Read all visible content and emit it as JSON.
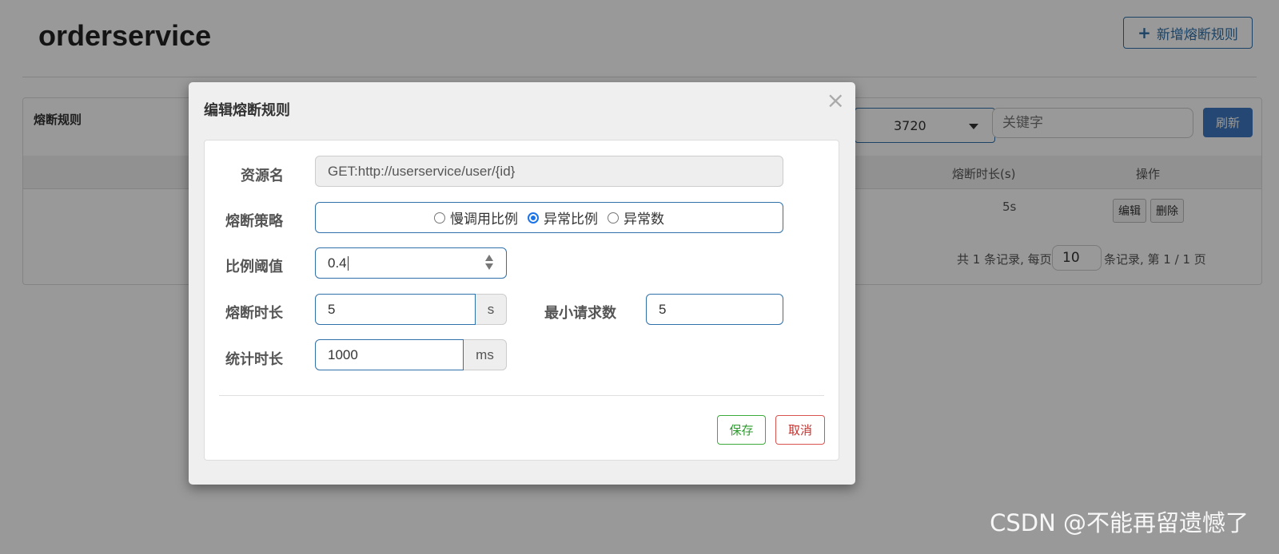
{
  "page": {
    "title": "orderservice",
    "add_rule_label": "新增熔断规则"
  },
  "panel": {
    "title": "熔断规则",
    "ip_select_value": "3720",
    "search_placeholder": "关键字",
    "refresh_label": "刷新",
    "columns": [
      "熔断时长(s)",
      "操作"
    ],
    "rows": [
      {
        "duration": "5s",
        "edit_label": "编辑",
        "delete_label": "删除"
      }
    ],
    "pager": {
      "prefix": "共 1 条记录, 每页",
      "page_size": "10",
      "suffix": "条记录, 第 1 / 1 页"
    }
  },
  "modal": {
    "title": "编辑熔断规则",
    "close_glyph": "×",
    "resource": {
      "label": "资源名",
      "value": "GET:http://userservice/user/{id}"
    },
    "strategy": {
      "label": "熔断策略",
      "options": [
        {
          "label": "慢调用比例",
          "checked": false
        },
        {
          "label": "异常比例",
          "checked": true
        },
        {
          "label": "异常数",
          "checked": false
        }
      ]
    },
    "ratio": {
      "label": "比例阈值",
      "value": "0.4"
    },
    "duration": {
      "label": "熔断时长",
      "value": "5",
      "unit": "s"
    },
    "min_request": {
      "label": "最小请求数",
      "value": "5"
    },
    "stat_interval": {
      "label": "统计时长",
      "value": "1000",
      "unit": "ms"
    },
    "save_label": "保存",
    "cancel_label": "取消"
  },
  "watermark": "CSDN @不能再留遗憾了",
  "colors": {
    "primary": "#3071a9",
    "success": "#2e9b2e",
    "danger": "#c9302c",
    "radio_checked": "#1a73e8"
  }
}
